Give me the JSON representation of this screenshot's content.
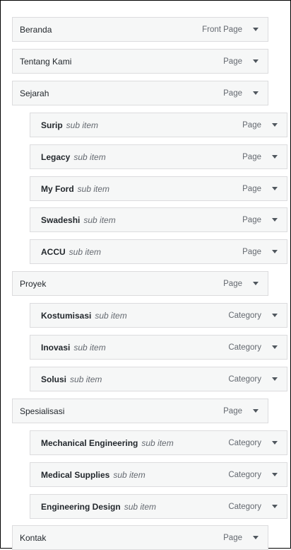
{
  "menu": {
    "items": [
      {
        "label": "Beranda",
        "sub": "",
        "type": "Front Page",
        "depth": 0
      },
      {
        "label": "Tentang Kami",
        "sub": "",
        "type": "Page",
        "depth": 0
      },
      {
        "label": "Sejarah",
        "sub": "",
        "type": "Page",
        "depth": 0
      },
      {
        "label": "Surip",
        "sub": "sub item",
        "type": "Page",
        "depth": 1
      },
      {
        "label": "Legacy",
        "sub": "sub item",
        "type": "Page",
        "depth": 1
      },
      {
        "label": "My Ford",
        "sub": "sub item",
        "type": "Page",
        "depth": 1
      },
      {
        "label": "Swadeshi",
        "sub": "sub item",
        "type": "Page",
        "depth": 1
      },
      {
        "label": "ACCU",
        "sub": "sub item",
        "type": "Page",
        "depth": 1
      },
      {
        "label": "Proyek",
        "sub": "",
        "type": "Page",
        "depth": 0
      },
      {
        "label": "Kostumisasi",
        "sub": "sub item",
        "type": "Category",
        "depth": 1
      },
      {
        "label": "Inovasi",
        "sub": "sub item",
        "type": "Category",
        "depth": 1
      },
      {
        "label": "Solusi",
        "sub": "sub item",
        "type": "Category",
        "depth": 1
      },
      {
        "label": "Spesialisasi",
        "sub": "",
        "type": "Page",
        "depth": 0
      },
      {
        "label": "Mechanical Engineering",
        "sub": "sub item",
        "type": "Category",
        "depth": 1
      },
      {
        "label": "Medical Supplies",
        "sub": "sub item",
        "type": "Category",
        "depth": 1
      },
      {
        "label": "Engineering Design",
        "sub": "sub item",
        "type": "Category",
        "depth": 1
      },
      {
        "label": "Kontak",
        "sub": "",
        "type": "Page",
        "depth": 0
      }
    ]
  },
  "icons": {
    "toggle": "chevron-down-icon"
  }
}
